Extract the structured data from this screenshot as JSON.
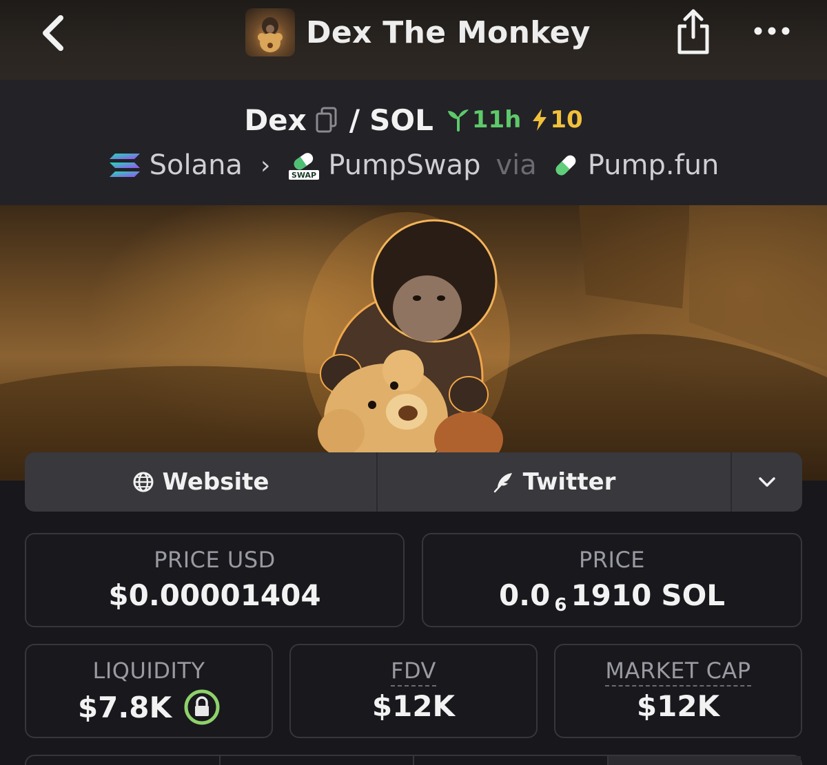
{
  "header": {
    "title": "Dex The Monkey",
    "back_icon": "chevron-left-icon",
    "share_icon": "share-icon",
    "more_icon": "more-horizontal-icon"
  },
  "pair": {
    "base": "Dex",
    "separator": "/",
    "quote": "SOL",
    "age": "11h",
    "boosts": "10",
    "age_color": "#5ec96a",
    "boost_color": "#f2c13b"
  },
  "route": {
    "chain": "Solana",
    "dex": "PumpSwap",
    "dex_badge": "SWAP",
    "via": "via",
    "launchpad": "Pump.fun"
  },
  "links": {
    "website": "Website",
    "twitter": "Twitter"
  },
  "stats": {
    "price_usd": {
      "label": "PRICE USD",
      "value": "$0.00001404"
    },
    "price_native": {
      "label": "PRICE",
      "prefix": "0.0",
      "zeros": "6",
      "digits": "1910",
      "unit": "SOL"
    },
    "liquidity": {
      "label": "LIQUIDITY",
      "value": "$7.8K",
      "locked": true
    },
    "fdv": {
      "label": "FDV",
      "value": "$12K"
    },
    "market_cap": {
      "label": "MARKET CAP",
      "value": "$12K"
    }
  },
  "colors": {
    "background": "#17171c",
    "card_border": "#36363c",
    "lock_ring": "#8fd16a"
  }
}
